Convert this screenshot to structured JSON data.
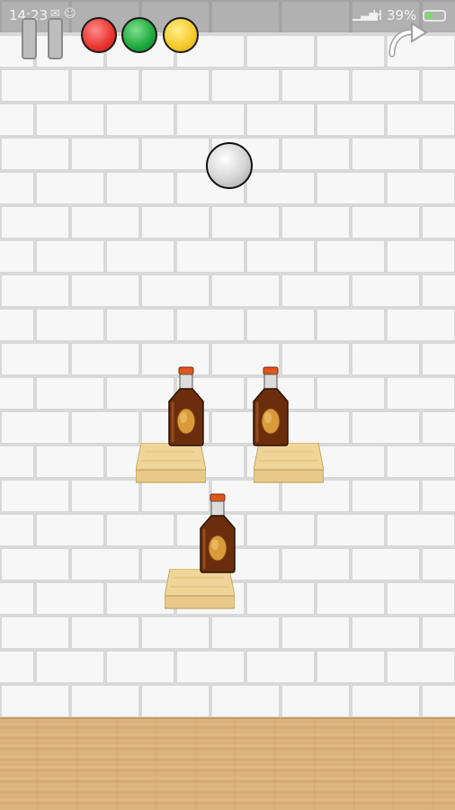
{
  "status_bar": {
    "time": "14:23",
    "notification_icons": "✉ ☺",
    "signal": "▁▃▅",
    "network": "H",
    "battery_percent": "39%",
    "battery_level": 0.39
  },
  "hud": {
    "pause_icon": "pause-icon",
    "lights": [
      {
        "name": "red",
        "color": "#e8342d"
      },
      {
        "name": "green",
        "color": "#1da83b"
      },
      {
        "name": "yellow",
        "color": "#f6c92a"
      }
    ],
    "restart_icon": "restart-arrow-icon"
  },
  "scene": {
    "wall_color": "#f3f3f3",
    "grout_color": "#cfcfcf",
    "floor_color": "#dfb583",
    "shelf_color": "#e8c98a",
    "bottle_color": "#6b2e0c",
    "cap_color": "#e0561f",
    "ball_color": "#d4d4d4",
    "targets": [
      {
        "name": "bottle-left"
      },
      {
        "name": "bottle-right"
      },
      {
        "name": "bottle-bottom"
      }
    ]
  }
}
